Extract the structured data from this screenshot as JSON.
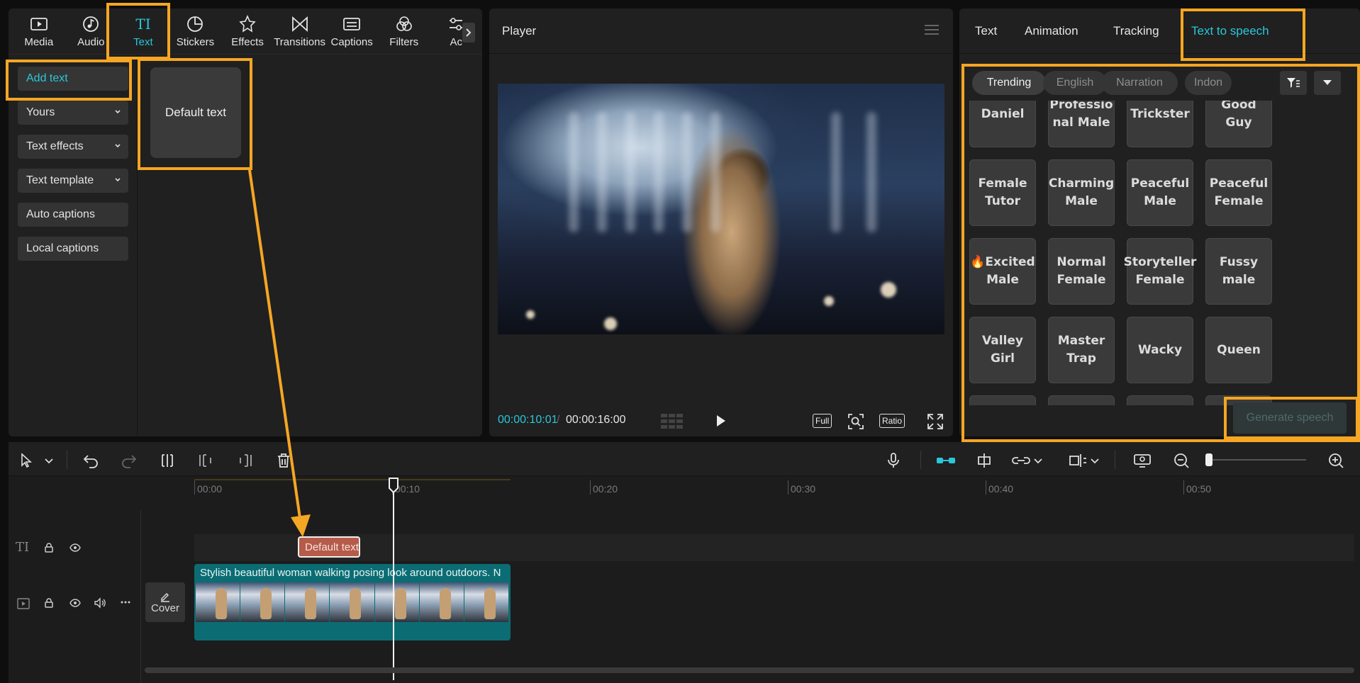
{
  "toolbar": {
    "tools": [
      {
        "id": "media",
        "label": "Media",
        "icon": "media-icon"
      },
      {
        "id": "audio",
        "label": "Audio",
        "icon": "audio-icon"
      },
      {
        "id": "text",
        "label": "Text",
        "icon": "text-icon",
        "active": true
      },
      {
        "id": "stickers",
        "label": "Stickers",
        "icon": "stickers-icon"
      },
      {
        "id": "effects",
        "label": "Effects",
        "icon": "effects-icon"
      },
      {
        "id": "transitions",
        "label": "Transitions",
        "icon": "transitions-icon"
      },
      {
        "id": "captions",
        "label": "Captions",
        "icon": "captions-icon"
      },
      {
        "id": "filters",
        "label": "Filters",
        "icon": "filters-icon"
      },
      {
        "id": "adjust",
        "label": "Ac",
        "icon": "adjust-icon"
      }
    ],
    "text_icon_glyph": "TI"
  },
  "side_nav": [
    {
      "label": "Add text",
      "active": true
    },
    {
      "label": "Yours",
      "has_chevron": true
    },
    {
      "label": "Text effects",
      "has_chevron": true
    },
    {
      "label": "Text template",
      "has_chevron": true
    },
    {
      "label": "Auto captions"
    },
    {
      "label": "Local captions"
    }
  ],
  "text_presets": {
    "default_label": "Default text"
  },
  "player": {
    "title": "Player",
    "current_time": "00:00:10:01",
    "separator": "/",
    "total_time": "00:00:16:00",
    "full_label": "Full",
    "ratio_label": "Ratio"
  },
  "right_panel": {
    "tabs": [
      {
        "label": "Text"
      },
      {
        "label": "Animation"
      },
      {
        "label": "Tracking"
      },
      {
        "label": "Text to speech",
        "active": true
      }
    ],
    "filters": [
      {
        "label": "Trending",
        "active": true
      },
      {
        "label": "English"
      },
      {
        "label": "Narration"
      },
      {
        "label": "Indon"
      }
    ],
    "voices": [
      [
        "Daniel",
        "Professio nal Male",
        "Trickster",
        "Good Guy"
      ],
      [
        "Female Tutor",
        "Charming Male",
        "Peaceful Male",
        "Peaceful Female"
      ],
      [
        "🔥Excited Male",
        "Normal Female",
        "Storyteller Female",
        "Fussy male"
      ],
      [
        "Valley Girl",
        "Master Trap",
        "Wacky",
        "Queen"
      ]
    ],
    "generate_label": "Generate speech"
  },
  "timeline": {
    "ruler": [
      "00:00",
      "00:10",
      "00:20",
      "00:30",
      "00:40",
      "00:50"
    ],
    "text_track_icon": "TI",
    "text_clip_label": "Default text",
    "video_clip_caption": "Stylish beautiful woman walking posing look around outdoors. N",
    "cover_label": "Cover"
  },
  "colors": {
    "accent": "#2ac7d8",
    "highlight": "#f5a623",
    "text_clip": "#b65a49",
    "video_clip": "#0b6d73"
  }
}
